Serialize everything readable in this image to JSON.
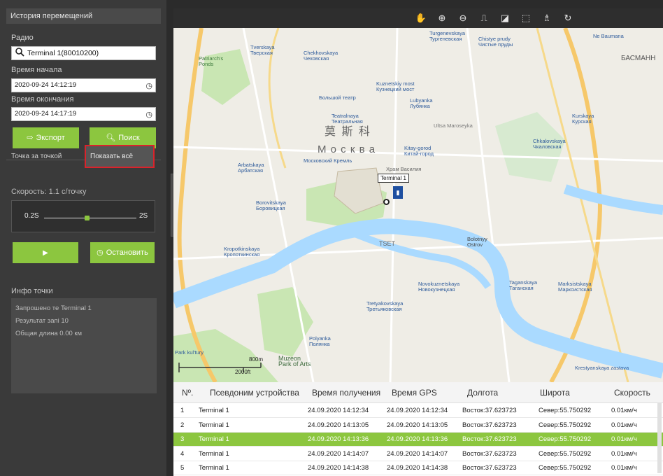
{
  "panel": {
    "title": "История перемещений",
    "radio_label": "Радио",
    "radio_value": "Terminal 1(80010200)",
    "start_label": "Время начала",
    "start_value": "2020-09-24 14:12:19",
    "end_label": "Время окончания",
    "end_value": "2020-09-24 14:17:19",
    "export_btn": "Экспорт",
    "search_btn": "Поиск",
    "point_by_point": "Точка за точкой",
    "show_all": "Показать всё",
    "speed_label": "Скорость: 1.1 с/точку",
    "speed_min": "0.2S",
    "speed_max": "2S",
    "speed_level": 0.46,
    "play_icon": "play-icon",
    "stop_btn": "Остановить",
    "info_title": "Инфо точки",
    "info_lines": [
      "Запрошено те Terminal 1",
      "Результат запі 10",
      "Общая длина  0.00 км"
    ]
  },
  "map": {
    "marker_label": "Terminal 1",
    "scale_m": "800m",
    "scale_ft": "2000ft",
    "city_cn": "莫 斯 科",
    "city_ru": "М о с к в а",
    "labels": [
      "Tverskaya\nТверская",
      "Chekhovskaya\nЧеховская",
      "Turgenevskaya\nТургеневская",
      "Chistye prudy\nЧистые пруды",
      "Patriarch's\nPonds",
      "Kuznetskiy most\nКузнецкий мост",
      "Lubyanka\nЛубянка",
      "Teatralnaya\nТеатральная",
      "Kitay-gorod\nКитай-город",
      "Arbatskaya\nАрбатская",
      "Borovitskaya\nБоровицкая",
      "Kropotkinskaya\nКропоткинская",
      "Kurskaya\nКурская",
      "Chkalovskaya\nЧкаловская",
      "Novokuznetskaya\nНовокузнецкая",
      "Tretyakovskaya\nТретьяковская",
      "Taganskaya\nТаганская",
      "Marksistskaya\nМарксистская",
      "Polyanka\nПолянка",
      "Muzeon\nPark of Arts",
      "Bolotnyy\nOstrov",
      "Krestyanskaya zastava",
      "Park kul'tury",
      "Ne Baumana",
      "БАСМАНН",
      "TSET",
      "Ultsa Maroseyka",
      "Храм Василия",
      "Большой театр",
      "Московский Кремль"
    ]
  },
  "table": {
    "headers": [
      "Nº.",
      "Псевдоним устройства",
      "Время получения",
      "Время GPS",
      "Долгота",
      "Широта",
      "Скорость"
    ],
    "rows": [
      [
        "1",
        "Terminal 1",
        "24.09.2020 14:12:34",
        "24.09.2020 14:12:34",
        "Восток:37.623723",
        "Север:55.750292",
        "0.01км/ч"
      ],
      [
        "2",
        "Terminal 1",
        "24.09.2020 14:13:05",
        "24.09.2020 14:13:05",
        "Восток:37.623723",
        "Север:55.750292",
        "0.01км/ч"
      ],
      [
        "3",
        "Terminal 1",
        "24.09.2020 14:13:36",
        "24.09.2020 14:13:36",
        "Восток:37.623723",
        "Север:55.750292",
        "0.01км/ч"
      ],
      [
        "4",
        "Terminal 1",
        "24.09.2020 14:14:07",
        "24.09.2020 14:14:07",
        "Восток:37.623723",
        "Север:55.750292",
        "0.01км/ч"
      ],
      [
        "5",
        "Terminal 1",
        "24.09.2020 14:14:38",
        "24.09.2020 14:14:38",
        "Восток:37.623723",
        "Север:55.750292",
        "0.01км/ч"
      ]
    ],
    "selected_row": 3
  },
  "colors": {
    "accent": "#8cc63f",
    "highlight": "#d9232b",
    "river": "#aadaff"
  }
}
